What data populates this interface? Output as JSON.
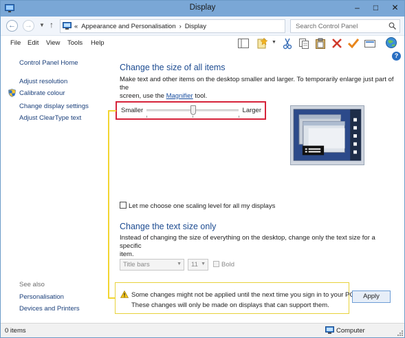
{
  "window": {
    "title": "Display",
    "minimize": "–",
    "maximize": "□",
    "close": "✕"
  },
  "address": {
    "crumbs": [
      "«",
      "Appearance and Personalisation",
      "›",
      "Display"
    ],
    "search_placeholder": "Search Control Panel"
  },
  "menu": [
    "File",
    "Edit",
    "View",
    "Tools",
    "Help"
  ],
  "toolbar_icons": [
    "panel-icon",
    "favorites-icon",
    "cut-icon",
    "copy-icon",
    "paste-icon",
    "delete-icon",
    "checkmark-icon",
    "properties-icon",
    "globe-icon"
  ],
  "sidebar": {
    "home": "Control Panel Home",
    "items": [
      "Adjust resolution",
      "Calibrate colour",
      "Change display settings",
      "Adjust ClearType text"
    ],
    "see_also_label": "See also",
    "see_also": [
      "Personalisation",
      "Devices and Printers"
    ]
  },
  "main": {
    "heading1": "Change the size of all items",
    "para1_a": "Make text and other items on the desktop smaller and larger. To temporarily enlarge just part of the",
    "para1_b": "screen, use the ",
    "para1_link": "Magnifier",
    "para1_c": " tool.",
    "slider": {
      "left_label": "Smaller",
      "right_label": "Larger",
      "level": 0.5
    },
    "checkbox_label": "Let me choose one scaling level for all my displays",
    "heading2": "Change the text size only",
    "para2_a": "Instead of changing the size of everything on the desktop, change only the text size for a specific",
    "para2_b": "item.",
    "item_select": "Title bars",
    "size_select": "11",
    "bold_label": "Bold",
    "notice_line1": "Some changes might not be applied until the next time you sign in to your PC.",
    "notice_line2": "These changes will only be made on displays that can support them.",
    "apply_label": "Apply"
  },
  "status": {
    "items": "0 items",
    "location": "Computer"
  },
  "colors": {
    "titlebar": "#7aa7d6",
    "heading": "#1c4b91",
    "link": "#1a3f7a",
    "highlight": "#d6233a",
    "guide": "#f2d531"
  }
}
